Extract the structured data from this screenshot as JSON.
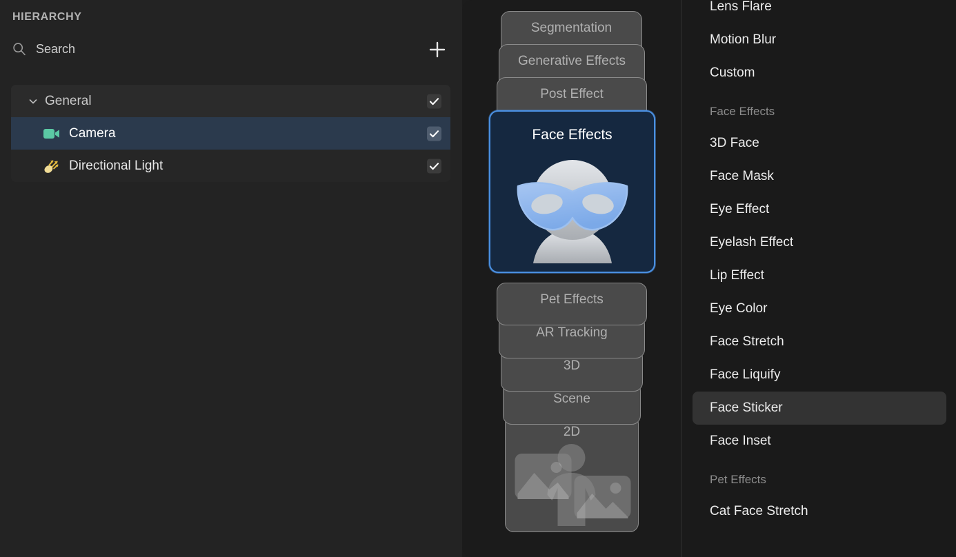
{
  "hierarchy": {
    "title": "HIERARCHY",
    "search": {
      "placeholder": "Search",
      "value": "",
      "icon": "search-icon"
    },
    "add_button_icon": "plus-icon",
    "rows": [
      {
        "label": "General",
        "type": "group",
        "icon": "chevron-down-icon",
        "checked": true,
        "selected": false
      },
      {
        "label": "Camera",
        "type": "child",
        "icon": "video-camera-icon",
        "checked": true,
        "selected": true
      },
      {
        "label": "Directional Light",
        "type": "child",
        "icon": "directional-light-icon",
        "checked": true,
        "selected": false
      }
    ]
  },
  "stack": {
    "top_cards": [
      {
        "label": "Segmentation"
      },
      {
        "label": "Generative Effects"
      },
      {
        "label": "Post Effect"
      }
    ],
    "selected_card": {
      "label": "Face Effects",
      "art": "masked-face-icon"
    },
    "bottom_cards": [
      {
        "label": "Pet Effects",
        "art": ""
      },
      {
        "label": "AR Tracking",
        "art": ""
      },
      {
        "label": "3D",
        "art": ""
      },
      {
        "label": "Scene",
        "art": ""
      },
      {
        "label": "2D",
        "art": "person-with-photos-icon"
      }
    ]
  },
  "effects_list": [
    {
      "kind": "item",
      "label": "Lens Flare",
      "active": false
    },
    {
      "kind": "item",
      "label": "Motion Blur",
      "active": false
    },
    {
      "kind": "item",
      "label": "Custom",
      "active": false
    },
    {
      "kind": "header",
      "label": "Face Effects"
    },
    {
      "kind": "item",
      "label": "3D Face",
      "active": false
    },
    {
      "kind": "item",
      "label": "Face Mask",
      "active": false
    },
    {
      "kind": "item",
      "label": "Eye Effect",
      "active": false
    },
    {
      "kind": "item",
      "label": "Eyelash Effect",
      "active": false
    },
    {
      "kind": "item",
      "label": "Lip Effect",
      "active": false
    },
    {
      "kind": "item",
      "label": "Eye Color",
      "active": false
    },
    {
      "kind": "item",
      "label": "Face Stretch",
      "active": false
    },
    {
      "kind": "item",
      "label": "Face Liquify",
      "active": false
    },
    {
      "kind": "item",
      "label": "Face Sticker",
      "active": true
    },
    {
      "kind": "item",
      "label": "Face Inset",
      "active": false
    },
    {
      "kind": "header",
      "label": "Pet Effects"
    },
    {
      "kind": "item",
      "label": "Cat Face Stretch",
      "active": false
    }
  ],
  "colors": {
    "accent_blue": "#4a90e2",
    "selected_row": "#2b3a4d",
    "camera_icon": "#5bc9a4",
    "light_icon": "#f0dc96",
    "panel_bg": "#232323",
    "list_bg": "#1a1a1a",
    "active_item": "#333333"
  }
}
